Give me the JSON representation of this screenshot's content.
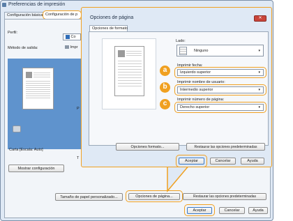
{
  "window": {
    "title": "Preferencias de impresión"
  },
  "tabs": [
    {
      "label": "Configuración básica"
    },
    {
      "label": "Configuración de p"
    }
  ],
  "left": {
    "perfil_label": "Perfil:",
    "perfil_value": "Co",
    "metodo_label": "Método de salida:",
    "metodo_value": "Impr",
    "carta_label": "Carta [Escala: Auto]",
    "mostrar_button": "Mostrar configuración",
    "frag_p": "P",
    "frag_t": "T"
  },
  "bottom": {
    "tamano_button": "Tamaño de papel personalizado...",
    "opciones_button": "Opciones de página...",
    "restaurar_button": "Restaurar las opciones predeterminadas",
    "aceptar": "Aceptar",
    "cancelar": "Cancelar",
    "ayuda": "Ayuda"
  },
  "dialog": {
    "title": "Opciones de página",
    "close_glyph": "✕",
    "tab": "Opciones de formato",
    "lado_label": "Lado:",
    "lado_value": "Ninguno",
    "fecha_label": "Imprimir fecha:",
    "fecha_value": "Izquierdo superior",
    "usuario_label": "Imprimir nombre de usuario:",
    "usuario_value": "Intermedio superior",
    "pagina_label": "Imprimir número de página:",
    "pagina_value": "Derecho superior",
    "opciones_formato_button": "Opciones formato...",
    "restaurar_button": "Restaurar las opciones predeterminadas",
    "aceptar": "Aceptar",
    "cancelar": "Cancelar",
    "ayuda": "Ayuda",
    "caret": "▾"
  },
  "badges": [
    "a",
    "b",
    "c"
  ],
  "colors": {
    "highlight": "#f0a020",
    "preview": "#5f93cd",
    "close": "#c9453a"
  }
}
